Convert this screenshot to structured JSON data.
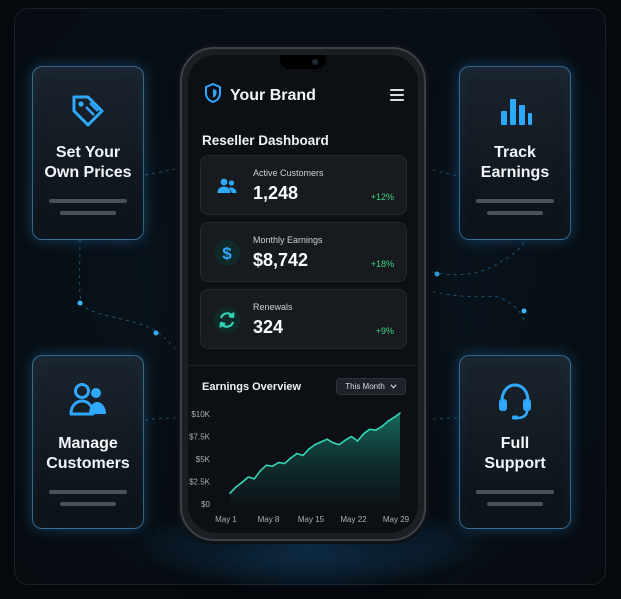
{
  "cards": {
    "prices": {
      "title_line1": "Set Your",
      "title_line2": "Own Prices",
      "icon": "price-tag-icon"
    },
    "earnings": {
      "title_line1": "Track",
      "title_line2": "Earnings",
      "icon": "bar-chart-icon"
    },
    "customers": {
      "title_line1": "Manage",
      "title_line2": "Customers",
      "icon": "users-icon"
    },
    "support": {
      "title_line1": "Full",
      "title_line2": "Support",
      "icon": "headset-icon"
    }
  },
  "app": {
    "brand_name": "Your Brand",
    "dashboard_title": "Reseller Dashboard",
    "stats": [
      {
        "label": "Active Customers",
        "value": "1,248",
        "change": "+12%",
        "icon": "users-icon"
      },
      {
        "label": "Monthly Earnings",
        "value": "$8,742",
        "change": "+18%",
        "icon": "dollar-icon"
      },
      {
        "label": "Renewals",
        "value": "324",
        "change": "+9%",
        "icon": "refresh-icon"
      }
    ],
    "overview": {
      "title": "Earnings Overview",
      "period": "This Month"
    }
  },
  "colors": {
    "accent": "#2fa8ff",
    "positive": "#3ed47c",
    "chart_line": "#34d6b8"
  },
  "chart_data": {
    "type": "area",
    "title": "Earnings Overview",
    "x_tick_labels": [
      "May 1",
      "May 8",
      "May 15",
      "May 22",
      "May 29"
    ],
    "y_tick_labels": [
      "$0",
      "$2.5K",
      "$5K",
      "$7.5K",
      "$10K"
    ],
    "ylim": [
      0,
      10000
    ],
    "xlim": [
      1,
      29
    ],
    "x": [
      1,
      2,
      3,
      4,
      5,
      6,
      7,
      8,
      9,
      10,
      11,
      12,
      13,
      14,
      15,
      16,
      17,
      18,
      19,
      20,
      21,
      22,
      23,
      24,
      25,
      26,
      27,
      28,
      29
    ],
    "values": [
      1200,
      1900,
      2400,
      3000,
      2800,
      3700,
      4300,
      4200,
      4600,
      4500,
      5100,
      5600,
      5400,
      6100,
      6600,
      6900,
      7200,
      6800,
      6600,
      7100,
      7500,
      7000,
      7800,
      8300,
      8200,
      8600,
      9200,
      9600,
      10100
    ],
    "grid": false,
    "legend": "none"
  }
}
